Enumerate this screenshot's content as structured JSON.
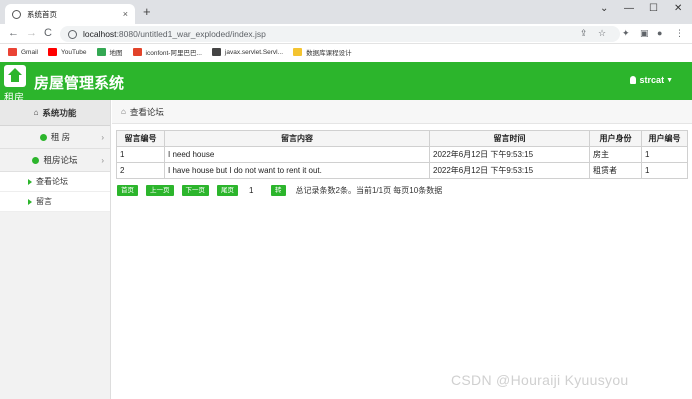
{
  "browser": {
    "tab_title": "系统首页",
    "tab_close": "×",
    "new_tab": "+",
    "win_min": "—",
    "win_max": "☐",
    "win_close": "✕",
    "back": "←",
    "forward": "→",
    "reload": "C",
    "url_host": "localhost",
    "url_path": ":8080/untitled1_war_exploded/index.jsp",
    "bookmarks": [
      {
        "label": "Gmail",
        "color": "#ea4335"
      },
      {
        "label": "YouTube",
        "color": "#ff0000"
      },
      {
        "label": "地图",
        "color": "#34a853"
      },
      {
        "label": "iconfont-阿里巴巴...",
        "color": "#e2432a"
      },
      {
        "label": "javax.servlet.Servl...",
        "color": "#444444"
      },
      {
        "label": "数据库课程设计",
        "color": "#f4c430"
      }
    ]
  },
  "header": {
    "logo_sub": "租房",
    "title": "房屋管理系统",
    "user": "strcat",
    "accent": "#2cb52c"
  },
  "sidebar": {
    "head": "系统功能",
    "items": [
      {
        "label": "租 房"
      },
      {
        "label": "租房论坛"
      }
    ],
    "subitems": [
      {
        "label": "查看论坛"
      },
      {
        "label": "留言"
      }
    ]
  },
  "main": {
    "breadcrumb": "查看论坛",
    "columns": [
      "留言编号",
      "留言内容",
      "留言时间",
      "用户身份",
      "用户编号"
    ],
    "rows": [
      [
        "1",
        "I need house",
        "2022年6月12日 下午9:53:15",
        "房主",
        "1"
      ],
      [
        "2",
        "I have house but I do not want to rent it out.",
        "2022年6月12日 下午9:53:15",
        "租赁者",
        "1"
      ]
    ],
    "pager": {
      "first": "首页",
      "prev": "上一页",
      "next": "下一页",
      "last": "尾页",
      "page_value": "1",
      "go": "转",
      "info": "总记录条数2条。当前1/1页 每页10条数据"
    }
  },
  "watermark": "CSDN @Houraiji Kyuusyou"
}
